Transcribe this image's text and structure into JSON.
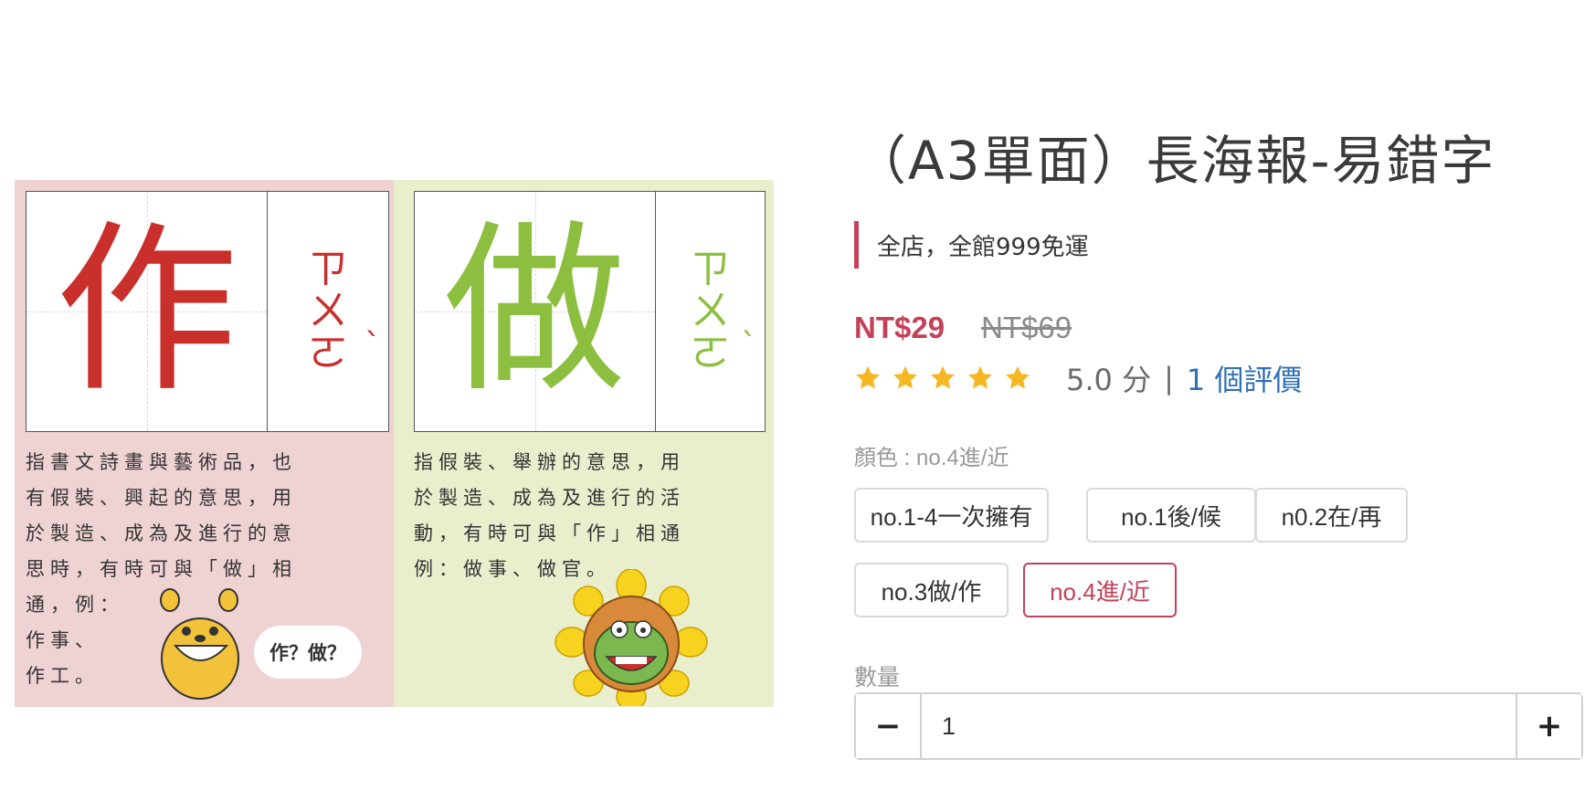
{
  "product": {
    "title": "（A3單面）長海報-易錯字",
    "promo": "全店，全館999免運",
    "price_now": "NT$29",
    "price_old": "NT$69",
    "rating": {
      "stars": 5,
      "score_text": "5.0 分",
      "separator": "|",
      "reviews_text": "1 個評價"
    },
    "color_label": "顏色 : no.4進/近",
    "options": [
      {
        "label": "no.1-4一次擁有",
        "selected": false
      },
      {
        "label": "no.1後/候",
        "selected": false
      },
      {
        "label": "n0.2在/再",
        "selected": false
      },
      {
        "label": "no.3做/作",
        "selected": false
      },
      {
        "label": "no.4進/近",
        "selected": true
      }
    ],
    "quantity": {
      "label": "數量",
      "value": "1",
      "minus": "−",
      "plus": "+"
    }
  },
  "image": {
    "left": {
      "char": "作",
      "zhuyin": [
        "ㄗ",
        "ㄨ",
        "ㄛ"
      ],
      "tone": "ˋ",
      "desc_lines": [
        "指書文詩畫與藝術品，也",
        "有假裝、興起的意思，用",
        "於製造、成為及進行的意",
        "思時，有時可與「做」相",
        "通，例：",
        "作事、",
        "作工。"
      ],
      "bubble": "作？做？"
    },
    "right": {
      "char": "做",
      "zhuyin": [
        "ㄗ",
        "ㄨ",
        "ㄛ"
      ],
      "tone": "ˋ",
      "desc_lines": [
        "指假裝、舉辦的意思，用",
        "於製造、成為及進行的活",
        "動，有時可與「作」相通",
        "例：做事、做官。"
      ]
    }
  },
  "colors": {
    "accent": "#c3425a",
    "link": "#2f6fb7",
    "star": "#f5b823",
    "red_char": "#c9302c",
    "green_char": "#8cbf3f"
  }
}
